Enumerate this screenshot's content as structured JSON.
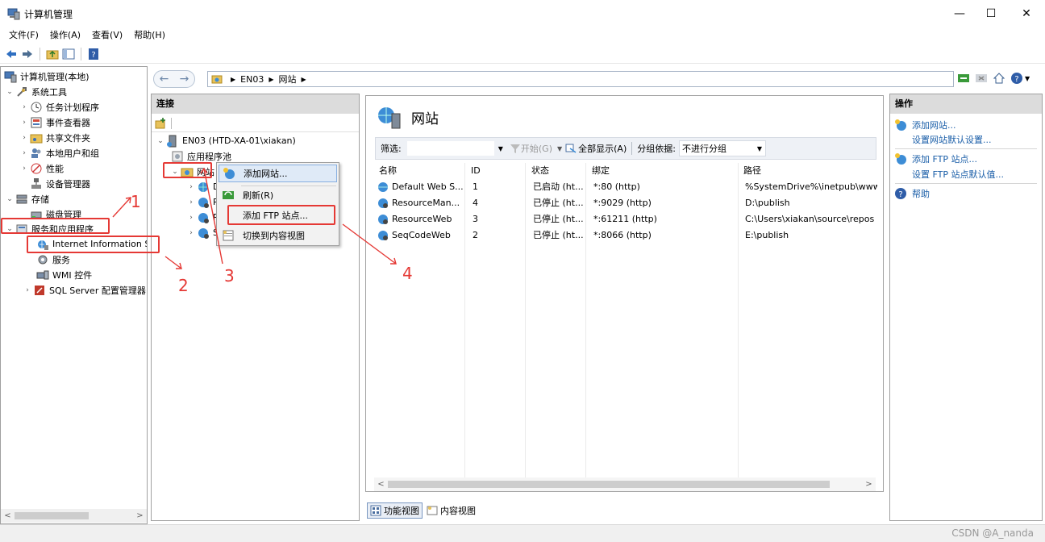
{
  "window": {
    "title": "计算机管理",
    "controls": {
      "minimize": "—",
      "maximize": "☐",
      "close": "✕"
    }
  },
  "menubar": {
    "items": [
      "文件(F)",
      "操作(A)",
      "查看(V)",
      "帮助(H)"
    ]
  },
  "left_tree": {
    "root": "计算机管理(本地)",
    "system_tools": "系统工具",
    "task_scheduler": "任务计划程序",
    "event_viewer": "事件查看器",
    "shared_folders": "共享文件夹",
    "local_users": "本地用户和组",
    "performance": "性能",
    "device_manager": "设备管理器",
    "storage": "存储",
    "disk_management": "磁盘管理",
    "services_apps": "服务和应用程序",
    "iis": "Internet Information S",
    "services": "服务",
    "wmi": "WMI 控件",
    "sql_server": "SQL Server 配置管理器"
  },
  "address": {
    "crumbs": [
      "EN03",
      "网站"
    ]
  },
  "connections": {
    "header": "连接",
    "server": "EN03 (HTD-XA-01\\xiakan)",
    "app_pools": "应用程序池",
    "sites": "网站",
    "child_initials": [
      "D",
      "R",
      "R",
      "S"
    ]
  },
  "context_menu": {
    "items": [
      "添加网站...",
      "刷新(R)",
      "添加 FTP 站点...",
      "切换到内容视图"
    ]
  },
  "content": {
    "title": "网站",
    "filter_label": "筛选:",
    "start_label": "开始(G)",
    "show_all_label": "全部显示(A)",
    "group_label": "分组依据:",
    "group_value": "不进行分组",
    "columns": [
      "名称",
      "ID",
      "状态",
      "绑定",
      "路径"
    ],
    "rows": [
      {
        "name": "Default Web S...",
        "id": "1",
        "status": "已启动 (ht...",
        "binding": "*:80 (http)",
        "path": "%SystemDrive%\\inetpub\\www"
      },
      {
        "name": "ResourceMan...",
        "id": "4",
        "status": "已停止 (ht...",
        "binding": "*:9029 (http)",
        "path": "D:\\publish"
      },
      {
        "name": "ResourceWeb",
        "id": "3",
        "status": "已停止 (ht...",
        "binding": "*:61211 (http)",
        "path": "C:\\Users\\xiakan\\source\\repos"
      },
      {
        "name": "SeqCodeWeb",
        "id": "2",
        "status": "已停止 (ht...",
        "binding": "*:8066 (http)",
        "path": "E:\\publish"
      }
    ]
  },
  "view_tabs": {
    "features": "功能视图",
    "content": "内容视图"
  },
  "actions": {
    "header": "操作",
    "add_site": "添加网站...",
    "site_defaults": "设置网站默认设置...",
    "add_ftp": "添加 FTP 站点...",
    "ftp_defaults": "设置 FTP 站点默认值...",
    "help": "帮助"
  },
  "annotations": {
    "labels": [
      "1",
      "2",
      "3",
      "4"
    ],
    "color": "#e53935"
  },
  "statusbar": {
    "watermark": "CSDN @A_nanda"
  }
}
